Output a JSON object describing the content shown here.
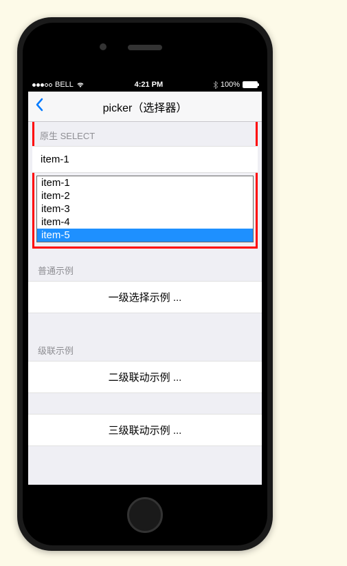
{
  "statusBar": {
    "carrier": "BELL",
    "time": "4:21 PM",
    "batteryPercent": "100%"
  },
  "nav": {
    "title": "picker（选择器）"
  },
  "sections": {
    "native": {
      "header": "原生 SELECT",
      "selectedValue": "item-1",
      "options": [
        "item-1",
        "item-2",
        "item-3",
        "item-4",
        "item-5"
      ],
      "highlightedIndex": 4
    },
    "normal": {
      "header": "普通示例",
      "item": "一级选择示例 ..."
    },
    "cascade": {
      "header": "级联示例",
      "item2": "二级联动示例 ...",
      "item3": "三级联动示例 ..."
    }
  }
}
